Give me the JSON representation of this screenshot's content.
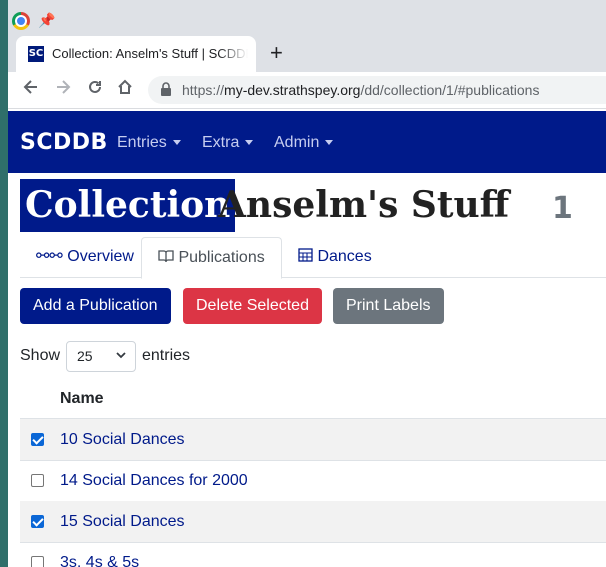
{
  "browser": {
    "tab_title": "Collection: Anselm's Stuff | SCDDB",
    "favicon_text": "SC",
    "new_tab": "+",
    "url_scheme": "https://",
    "url_host": "my-dev.strathspey.org",
    "url_path": "/dd/collection/1/#publications"
  },
  "navbar": {
    "brand": "SCDDB",
    "items": [
      {
        "label": "Entries"
      },
      {
        "label": "Extra"
      },
      {
        "label": "Admin"
      }
    ]
  },
  "page": {
    "badge": "Collection",
    "title": "Anselm's Stuff",
    "id": "1"
  },
  "tabs": [
    {
      "label": "Overview",
      "icon": "glasses-icon"
    },
    {
      "label": "Publications",
      "icon": "book-icon",
      "active": true
    },
    {
      "label": "Dances",
      "icon": "calendar-icon"
    }
  ],
  "actions": {
    "add": "Add a Publication",
    "delete": "Delete Selected",
    "print": "Print Labels"
  },
  "length": {
    "show": "Show",
    "value": "25",
    "entries": "entries"
  },
  "table": {
    "header": "Name",
    "rows": [
      {
        "name": "10 Social Dances",
        "checked": true
      },
      {
        "name": "14 Social Dances for 2000",
        "checked": false
      },
      {
        "name": "15 Social Dances",
        "checked": true
      },
      {
        "name": "3s, 4s & 5s",
        "checked": false
      }
    ]
  },
  "colors": {
    "primary": "#001a8a",
    "danger": "#dc3545",
    "secondary": "#6c757d"
  }
}
